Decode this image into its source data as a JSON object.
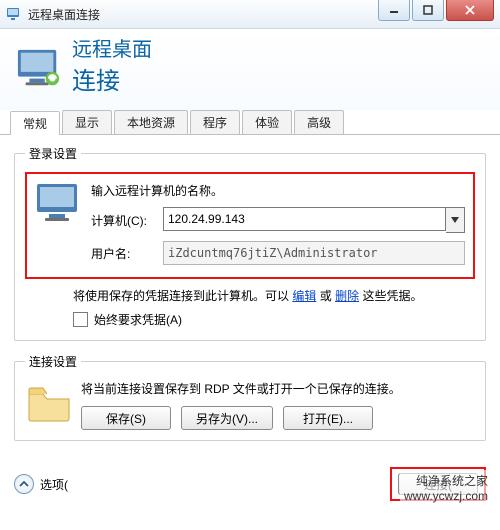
{
  "window": {
    "title": "远程桌面连接"
  },
  "banner": {
    "line1": "远程桌面",
    "line2": "连接"
  },
  "tabs": [
    "常规",
    "显示",
    "本地资源",
    "程序",
    "体验",
    "高级"
  ],
  "active_tab_index": 0,
  "login_group": {
    "legend": "登录设置",
    "prompt": "输入远程计算机的名称。",
    "computer_label": "计算机(C):",
    "computer_value": "120.24.99.143",
    "user_label": "用户名:",
    "user_value": "iZdcuntmq76jtiZ\\Administrator",
    "hint_prefix": "将使用保存的凭据连接到此计算机。可以",
    "hint_link_edit": "编辑",
    "hint_or": "或",
    "hint_link_delete": "删除",
    "hint_suffix": "这些凭据。",
    "always_ask": "始终要求凭据(A)"
  },
  "conn_group": {
    "legend": "连接设置",
    "text": "将当前连接设置保存到 RDP 文件或打开一个已保存的连接。",
    "save": "保存(S)",
    "save_as": "另存为(V)...",
    "open": "打开(E)..."
  },
  "footer": {
    "options": "选项(",
    "connect": "连接("
  },
  "watermark": "纯净系统之家\nwww.ycwzj.com"
}
